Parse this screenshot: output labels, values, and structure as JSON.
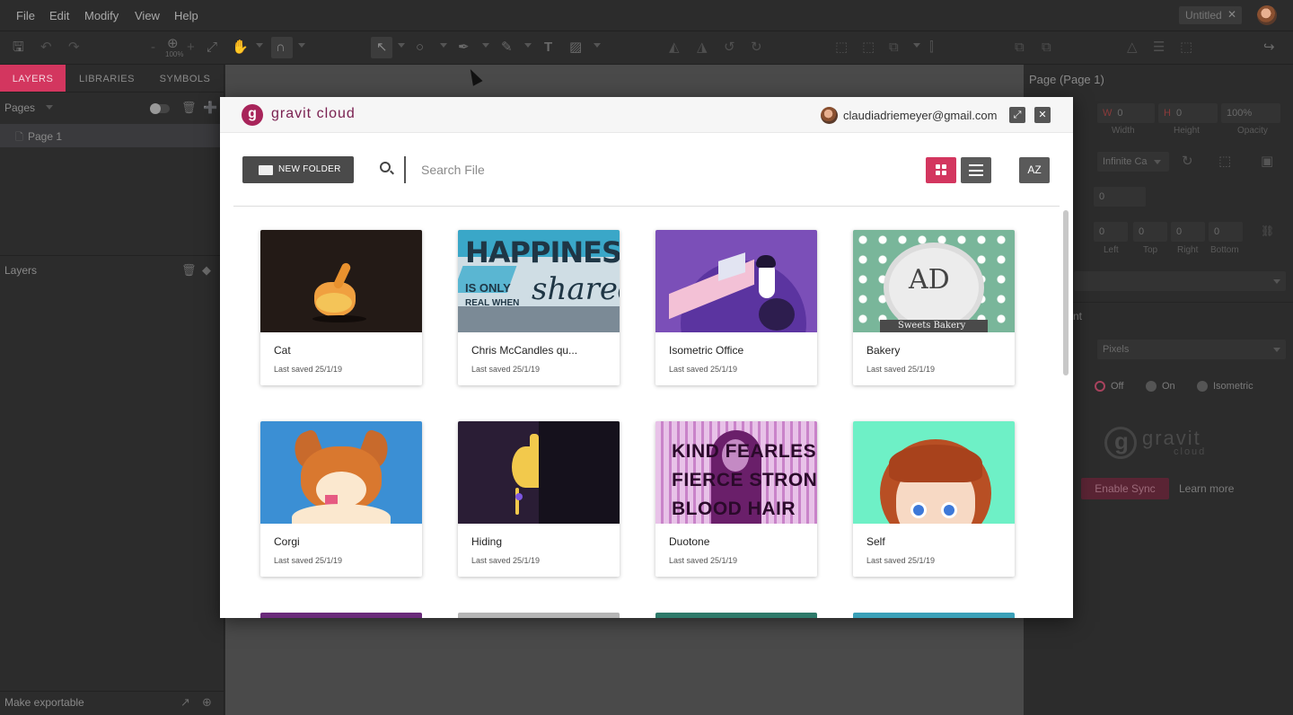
{
  "menubar": {
    "items": [
      "File",
      "Edit",
      "Modify",
      "View",
      "Help"
    ],
    "doc_tab": "Untitled",
    "doc_tab_close": "✕"
  },
  "toolbar": {
    "zoom_label": "100%"
  },
  "left_panel": {
    "tabs": [
      "LAYERS",
      "LIBRARIES",
      "SYMBOLS"
    ],
    "pages_label": "Pages",
    "page_item": "Page 1",
    "layers_label": "Layers",
    "footer": "Make exportable"
  },
  "right_panel": {
    "title": "Page (Page 1)",
    "width_value": "0",
    "height_value": "0",
    "opacity_value": "100%",
    "width_label": "Width",
    "height_label": "Height",
    "opacity_label": "Opacity",
    "size_select": "Infinite Ca",
    "bleed_value": "0",
    "margins": [
      "0",
      "0",
      "0",
      "0"
    ],
    "margin_labels": [
      "Left",
      "Top",
      "Right",
      "Bottom"
    ],
    "section_label": "nt",
    "units_select": "Pixels",
    "pixel_snap_options": [
      "Off",
      "On",
      "Isometric"
    ],
    "logo_text": "gravit",
    "logo_sub": "cloud",
    "sync_button": "Enable Sync",
    "learn_more": "Learn more"
  },
  "dialog": {
    "brand": "gravit cloud",
    "user_email": "claudiadriemeyer@gmail.com",
    "new_folder_label": "NEW FOLDER",
    "search_placeholder": "Search File",
    "sort_label": "AZ",
    "accent_color": "#d3365f",
    "files": [
      {
        "title": "Cat",
        "date": "Last saved 25/1/19"
      },
      {
        "title": "Chris McCandles qu...",
        "date": "Last saved 25/1/19"
      },
      {
        "title": "Isometric Office",
        "date": "Last saved 25/1/19"
      },
      {
        "title": "Bakery",
        "date": "Last saved 25/1/19"
      },
      {
        "title": "Corgi",
        "date": "Last saved 25/1/19"
      },
      {
        "title": "Hiding",
        "date": "Last saved 25/1/19"
      },
      {
        "title": "Duotone",
        "date": "Last saved 25/1/19"
      },
      {
        "title": "Self",
        "date": "Last saved 25/1/19"
      }
    ],
    "thumb_text": {
      "happiness": "HAPPINESS",
      "is_only": "IS ONLY",
      "real_when": "REAL WHEN",
      "shared": "shared",
      "bakery_mono": "AD",
      "bakery_name": "Sweets Bakery",
      "duotone_l1": "KIND FEARLESS",
      "duotone_l2": "FIERCE STRONG",
      "duotone_l3": "BLOOD HAIR"
    }
  }
}
